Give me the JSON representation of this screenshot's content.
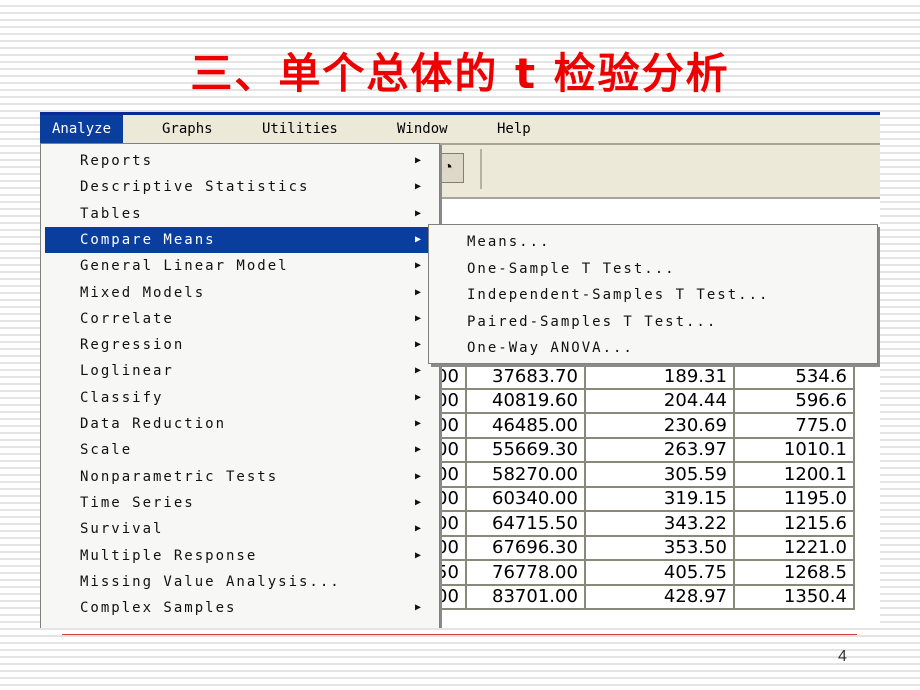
{
  "slide": {
    "title": "三、单个总体的 t 检验分析",
    "page_number": "4"
  },
  "menubar": {
    "items": [
      {
        "label": "Analyze",
        "active": true
      },
      {
        "label": "Graphs"
      },
      {
        "label": "Utilities"
      },
      {
        "label": "Window"
      },
      {
        "label": "Help"
      }
    ]
  },
  "analyze_menu": {
    "items": [
      {
        "label": "Reports",
        "submenu": true
      },
      {
        "label": "Descriptive Statistics",
        "submenu": true
      },
      {
        "label": "Tables",
        "submenu": true
      },
      {
        "label": "Compare Means",
        "submenu": true,
        "highlighted": true
      },
      {
        "label": "General Linear Model",
        "submenu": true
      },
      {
        "label": "Mixed Models",
        "submenu": true
      },
      {
        "label": "Correlate",
        "submenu": true
      },
      {
        "label": "Regression",
        "submenu": true
      },
      {
        "label": "Loglinear",
        "submenu": true
      },
      {
        "label": "Classify",
        "submenu": true
      },
      {
        "label": "Data Reduction",
        "submenu": true
      },
      {
        "label": "Scale",
        "submenu": true
      },
      {
        "label": "Nonparametric Tests",
        "submenu": true
      },
      {
        "label": "Time Series",
        "submenu": true
      },
      {
        "label": "Survival",
        "submenu": true
      },
      {
        "label": "Multiple Response",
        "submenu": true
      },
      {
        "label": "Missing Value Analysis...",
        "submenu": false
      },
      {
        "label": "Complex Samples",
        "submenu": true
      }
    ],
    "arrow_glyph": "▶"
  },
  "compare_means_submenu": {
    "items": [
      {
        "label": "Means..."
      },
      {
        "label": "One-Sample T Test..."
      },
      {
        "label": "Independent-Samples T Test..."
      },
      {
        "label": "Paired-Samples T Test..."
      },
      {
        "label": "One-Way ANOVA..."
      }
    ]
  },
  "toolbar": {
    "visible_button_icon": "toolbar-button-icon"
  },
  "data_grid": {
    "rows": [
      [
        "00",
        "37683.70",
        "189.31",
        "534.6"
      ],
      [
        "00",
        "40819.60",
        "204.44",
        "596.6"
      ],
      [
        "00",
        "46485.00",
        "230.69",
        "775.0"
      ],
      [
        "00",
        "55669.30",
        "263.97",
        "1010.1"
      ],
      [
        "00",
        "58270.00",
        "305.59",
        "1200.1"
      ],
      [
        "00",
        "60340.00",
        "319.15",
        "1195.0"
      ],
      [
        "00",
        "64715.50",
        "343.22",
        "1215.6"
      ],
      [
        "00",
        "67696.30",
        "353.50",
        "1221.0"
      ],
      [
        "50",
        "76778.00",
        "405.75",
        "1268.5"
      ],
      [
        "00",
        "83701.00",
        "428.97",
        "1350.4"
      ]
    ]
  }
}
